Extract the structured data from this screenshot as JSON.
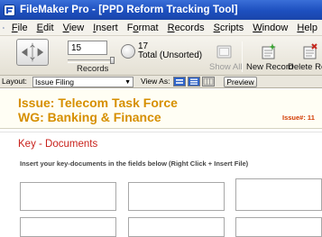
{
  "window": {
    "title": "FileMaker Pro - [PPD Reform Tracking Tool]"
  },
  "menubar": {
    "items": [
      {
        "label": "File",
        "underline": "F",
        "rest": "ile"
      },
      {
        "label": "Edit",
        "underline": "E",
        "rest": "dit"
      },
      {
        "label": "View",
        "underline": "V",
        "rest": "iew"
      },
      {
        "label": "Insert",
        "underline": "I",
        "rest": "nsert"
      },
      {
        "label": "Format",
        "pre": "F",
        "underline": "o",
        "rest": "rmat"
      },
      {
        "label": "Records",
        "underline": "R",
        "rest": "ecords"
      },
      {
        "label": "Scripts",
        "underline": "S",
        "rest": "cripts"
      },
      {
        "label": "Window",
        "underline": "W",
        "rest": "indow"
      },
      {
        "label": "Help",
        "underline": "H",
        "rest": "elp"
      }
    ]
  },
  "toolbar": {
    "current_record": "15",
    "records_label": "Records",
    "total_count": "17",
    "total_label": "Total (Unsorted)",
    "show_all_label": "Show All",
    "new_record_label": "New Record",
    "delete_record_label": "Delete Rec"
  },
  "layoutbar": {
    "layout_label": "Layout:",
    "layout_value": "Issue Filing",
    "view_as_label": "View As:",
    "preview_label": "Preview"
  },
  "record": {
    "issue_title": "Issue: Telecom Task Force",
    "wg_title": "WG: Banking & Finance",
    "issue_number_label": "Issue#: 11"
  },
  "section": {
    "title": "Key - Documents",
    "hint": "Insert your key-documents in the fields below (Right Click + Insert File)"
  },
  "colors": {
    "title_bar": "#1d4fbf",
    "header_text": "#d68f00",
    "section_title": "#c8211b",
    "issue_number": "#d23a00"
  }
}
